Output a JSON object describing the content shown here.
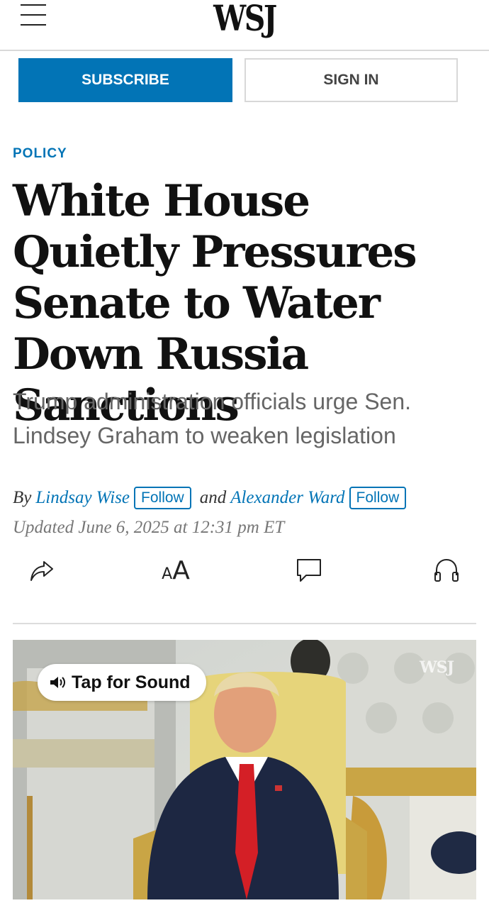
{
  "header": {
    "logo": "WSJ",
    "subscribe_label": "SUBSCRIBE",
    "signin_label": "SIGN IN"
  },
  "article": {
    "section": "POLICY",
    "headline": "White House Quietly Pressures Senate to Water Down Russia Sanctions",
    "dek": "Trump administration officials urge Sen. Lindsey Graham to weaken legislation",
    "byline": {
      "by": "By",
      "author1": "Lindsay Wise",
      "follow1": "Follow",
      "and": "and",
      "author2": "Alexander Ward",
      "follow2": "Follow"
    },
    "updated": "Updated June 6, 2025 at 12:31 pm ET"
  },
  "toolbar": {
    "share_icon": "share-icon",
    "font_icon": "font-size-icon",
    "comment_icon": "comment-icon",
    "audio_icon": "headphones-icon"
  },
  "video": {
    "tap_label": "Tap for Sound",
    "watermark": "WSJ"
  },
  "colors": {
    "accent": "#0274b6",
    "headline": "#111111",
    "dek": "#666666"
  }
}
